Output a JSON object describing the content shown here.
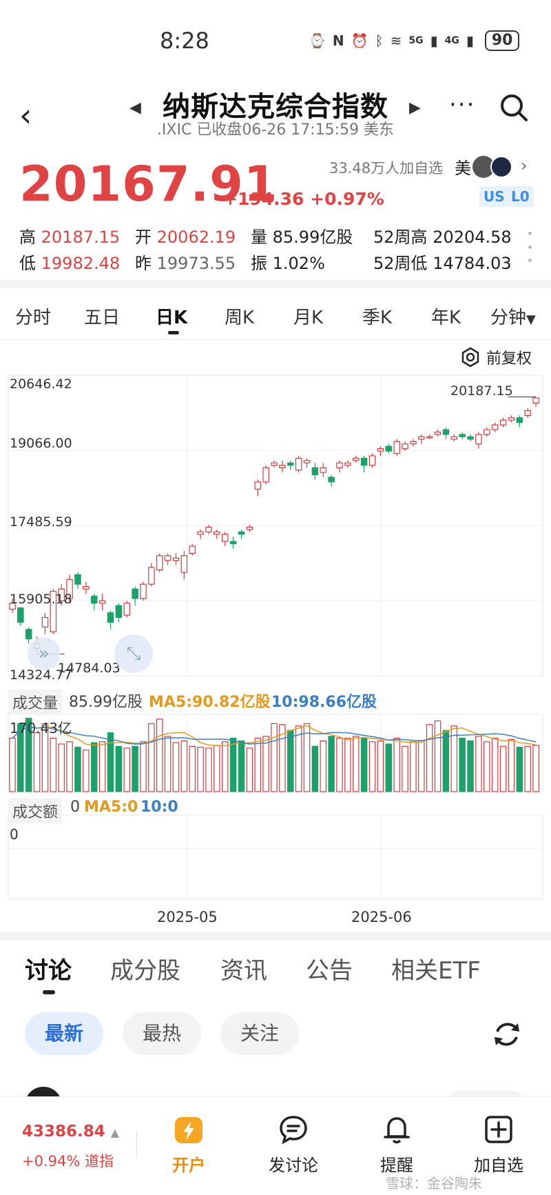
{
  "status": {
    "time": "8:28",
    "battery": "90",
    "net1": "5G",
    "net2": "4G"
  },
  "header": {
    "title": "纳斯达克综合指数",
    "subtitle": ".IXIC 已收盘06-26 17:15:59 美东"
  },
  "quote": {
    "price": "20167.91",
    "change": "+194.36 +0.97%",
    "followers": "33.48万人加自选",
    "mei": "美",
    "badges": [
      "US",
      "L0"
    ],
    "stats": [
      {
        "label": "高",
        "value": "20187.15",
        "color": "red"
      },
      {
        "label": "开",
        "value": "20062.19",
        "color": "red"
      },
      {
        "label": "量",
        "value": "85.99亿股",
        "color": "black"
      },
      {
        "label": "52周高",
        "value": "20204.58",
        "color": "black"
      },
      {
        "label": "低",
        "value": "19982.48",
        "color": "red"
      },
      {
        "label": "昨",
        "value": "19973.55",
        "color": "gray"
      },
      {
        "label": "振",
        "value": "1.02%",
        "color": "black"
      },
      {
        "label": "52周低",
        "value": "14784.03",
        "color": "black"
      }
    ]
  },
  "period_tabs": [
    "分时",
    "五日",
    "日K",
    "周K",
    "月K",
    "季K",
    "年K",
    "分钟"
  ],
  "active_period": "日K",
  "adjust": "前复权",
  "chart_data": {
    "type": "candlestick",
    "y_ticks": [
      "20646.42",
      "19066.00",
      "17485.59",
      "15905.18",
      "14324.77"
    ],
    "ylim": [
      14324.77,
      20646.42
    ],
    "max_label": "20187.15",
    "min_label": "14784.03",
    "x_ticks": [
      "2025-05",
      "2025-06"
    ],
    "candles": [
      [
        15725,
        15850,
        15650,
        15950
      ],
      [
        15750,
        15450,
        15380,
        15780
      ],
      [
        15300,
        15100,
        15000,
        15350
      ],
      [
        14900,
        15000,
        14784,
        15150
      ],
      [
        15350,
        15550,
        15200,
        15650
      ],
      [
        15250,
        16100,
        15200,
        16150
      ],
      [
        15900,
        16150,
        15800,
        16250
      ],
      [
        15950,
        16350,
        15850,
        16450
      ],
      [
        16450,
        16250,
        16150,
        16500
      ],
      [
        16150,
        16200,
        16050,
        16300
      ],
      [
        16000,
        15850,
        15700,
        16050
      ],
      [
        15850,
        15900,
        15700,
        16050
      ],
      [
        15650,
        15450,
        15300,
        15700
      ],
      [
        15800,
        15550,
        15450,
        15850
      ],
      [
        15600,
        15850,
        15550,
        15900
      ],
      [
        16150,
        15950,
        15800,
        16200
      ],
      [
        15950,
        16250,
        15900,
        16300
      ],
      [
        16250,
        16600,
        16200,
        16700
      ],
      [
        16550,
        16850,
        16500,
        16900
      ],
      [
        16750,
        16850,
        16650,
        16900
      ],
      [
        16750,
        16800,
        16650,
        16900
      ],
      [
        16500,
        16850,
        16350,
        16950
      ],
      [
        16900,
        17050,
        16850,
        17100
      ],
      [
        17300,
        17350,
        17200,
        17400
      ],
      [
        17350,
        17450,
        17300,
        17500
      ],
      [
        17300,
        17350,
        17200,
        17400
      ],
      [
        17150,
        17300,
        17050,
        17350
      ],
      [
        17150,
        17100,
        17000,
        17250
      ],
      [
        17350,
        17300,
        17200,
        17400
      ],
      [
        17400,
        17450,
        17350,
        17500
      ],
      [
        18250,
        18400,
        18100,
        18450
      ],
      [
        18400,
        18700,
        18350,
        18750
      ],
      [
        18750,
        18800,
        18700,
        18850
      ],
      [
        18700,
        18750,
        18600,
        18850
      ],
      [
        18800,
        18750,
        18650,
        18850
      ],
      [
        18650,
        18900,
        18600,
        18950
      ],
      [
        18800,
        18850,
        18700,
        18900
      ],
      [
        18700,
        18550,
        18450,
        18800
      ],
      [
        18600,
        18700,
        18500,
        18800
      ],
      [
        18500,
        18400,
        18300,
        18550
      ],
      [
        18700,
        18800,
        18600,
        18850
      ],
      [
        18750,
        18800,
        18700,
        18850
      ],
      [
        18850,
        18900,
        18800,
        18950
      ],
      [
        18900,
        18750,
        18600,
        18950
      ],
      [
        18750,
        18950,
        18700,
        19000
      ],
      [
        19050,
        19100,
        18950,
        19150
      ],
      [
        19150,
        19050,
        19000,
        19200
      ],
      [
        19000,
        19250,
        18950,
        19300
      ],
      [
        19100,
        19200,
        19050,
        19250
      ],
      [
        19200,
        19250,
        19150,
        19300
      ],
      [
        19300,
        19350,
        19200,
        19400
      ],
      [
        19350,
        19350,
        19300,
        19400
      ],
      [
        19400,
        19450,
        19350,
        19500
      ],
      [
        19500,
        19400,
        19300,
        19550
      ],
      [
        19300,
        19350,
        19250,
        19400
      ],
      [
        19400,
        19350,
        19300,
        19450
      ],
      [
        19350,
        19300,
        19250,
        19400
      ],
      [
        19200,
        19400,
        19100,
        19450
      ],
      [
        19400,
        19500,
        19350,
        19550
      ],
      [
        19500,
        19600,
        19450,
        19650
      ],
      [
        19600,
        19700,
        19550,
        19750
      ],
      [
        19700,
        19750,
        19650,
        19800
      ],
      [
        19750,
        19650,
        19550,
        19800
      ],
      [
        19800,
        19900,
        19750,
        19950
      ],
      [
        20062,
        20168,
        19982,
        20187
      ]
    ]
  },
  "volume": {
    "label": "成交量",
    "value": "85.99亿股",
    "ma5": "MA5:90.82亿股",
    "ma10": "10:98.66亿股",
    "max": "170.43亿",
    "bars": [
      118,
      150,
      162,
      130,
      150,
      118,
      105,
      110,
      98,
      92,
      108,
      110,
      130,
      100,
      96,
      100,
      110,
      150,
      160,
      122,
      108,
      112,
      100,
      98,
      96,
      102,
      110,
      118,
      112,
      96,
      118,
      122,
      150,
      148,
      135,
      145,
      150,
      100,
      112,
      122,
      118,
      118,
      122,
      118,
      110,
      112,
      105,
      118,
      100,
      110,
      112,
      148,
      156,
      135,
      145,
      118,
      112,
      122,
      110,
      118,
      100,
      115,
      98,
      100,
      102
    ]
  },
  "amount": {
    "label": "成交额",
    "value": "0",
    "ma5": "MA5:0",
    "ma10": "10:0",
    "axis": "0"
  },
  "bottom_tabs": [
    "讨论",
    "成分股",
    "资讯",
    "公告",
    "相关ETF"
  ],
  "filters": [
    "最新",
    "最热",
    "关注"
  ],
  "footer": {
    "index_value": "43386.84",
    "index_change": "+0.94% 道指",
    "buttons": [
      "开户",
      "发讨论",
      "提醒",
      "加自选"
    ]
  },
  "watermark": "雪球：金谷陶朱"
}
